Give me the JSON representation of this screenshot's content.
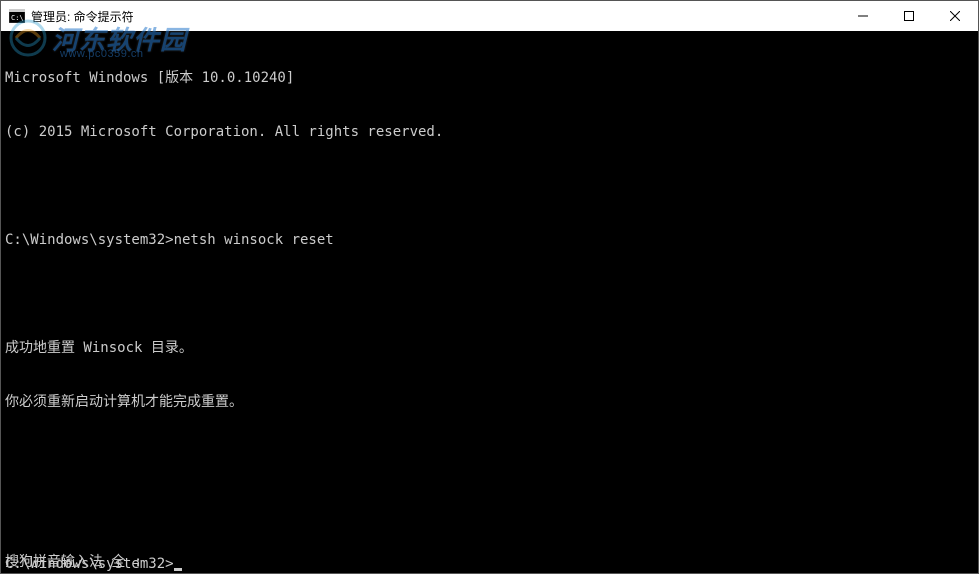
{
  "window": {
    "title": "管理员: 命令提示符"
  },
  "terminal": {
    "lines": [
      "Microsoft Windows [版本 10.0.10240]",
      "(c) 2015 Microsoft Corporation. All rights reserved.",
      "",
      "C:\\Windows\\system32>netsh winsock reset",
      "",
      "成功地重置 Winsock 目录。",
      "你必须重新启动计算机才能完成重置。",
      "",
      "",
      "C:\\Windows\\system32>"
    ],
    "ime_status": "搜狗拼音输入法 全 :"
  },
  "watermark": {
    "text": "河东软件园",
    "url": "www.pc0359.cn"
  }
}
